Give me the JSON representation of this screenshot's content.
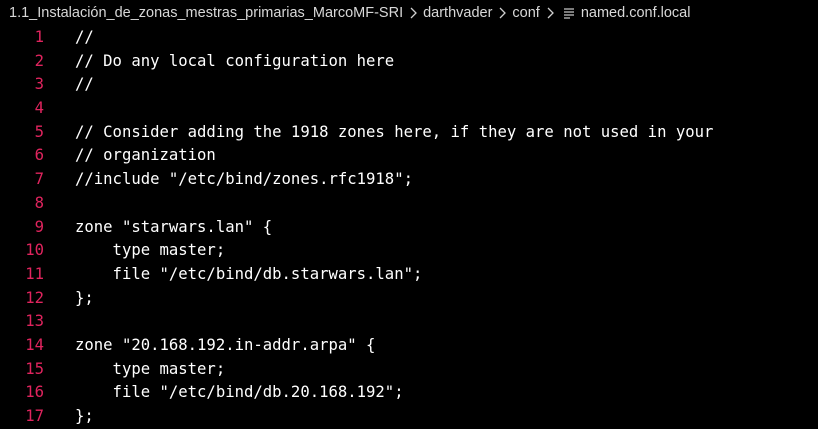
{
  "breadcrumb": {
    "items": [
      "1.1_Instalación_de_zonas_mestras_primarias_MarcoMF-SRI",
      "darthvader",
      "conf"
    ],
    "file": "named.conf.local"
  },
  "editor": {
    "line_number_color": "#e0245e",
    "text_color": "#ffffff",
    "background": "#000000",
    "lines": [
      {
        "num": "1",
        "text": "//"
      },
      {
        "num": "2",
        "text": "// Do any local configuration here"
      },
      {
        "num": "3",
        "text": "//"
      },
      {
        "num": "4",
        "text": ""
      },
      {
        "num": "5",
        "text": "// Consider adding the 1918 zones here, if they are not used in your"
      },
      {
        "num": "6",
        "text": "// organization"
      },
      {
        "num": "7",
        "text": "//include \"/etc/bind/zones.rfc1918\";"
      },
      {
        "num": "8",
        "text": ""
      },
      {
        "num": "9",
        "text": "zone \"starwars.lan\" {"
      },
      {
        "num": "10",
        "text": "    type master;"
      },
      {
        "num": "11",
        "text": "    file \"/etc/bind/db.starwars.lan\";"
      },
      {
        "num": "12",
        "text": "};"
      },
      {
        "num": "13",
        "text": ""
      },
      {
        "num": "14",
        "text": "zone \"20.168.192.in-addr.arpa\" {"
      },
      {
        "num": "15",
        "text": "    type master;"
      },
      {
        "num": "16",
        "text": "    file \"/etc/bind/db.20.168.192\";"
      },
      {
        "num": "17",
        "text": "};"
      }
    ]
  }
}
